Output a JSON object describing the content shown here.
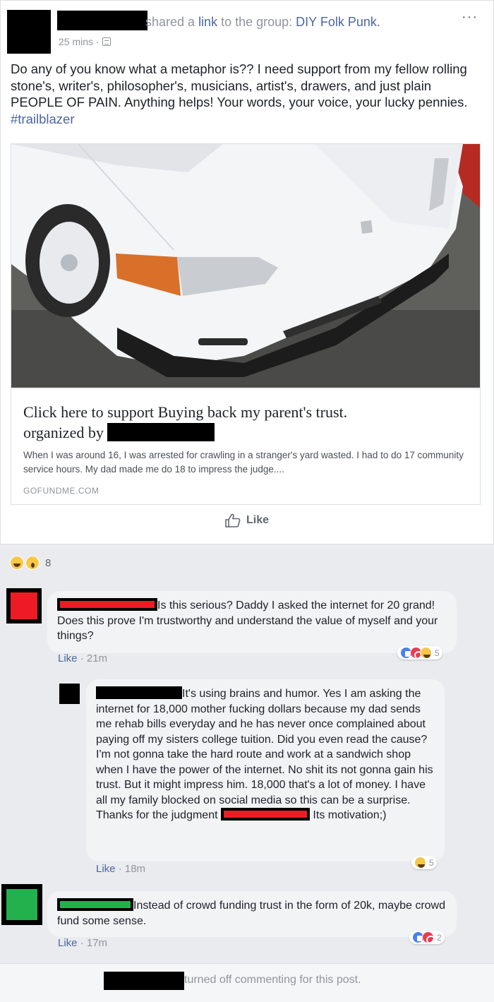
{
  "post": {
    "shared_prefix": "shared a ",
    "shared_link_word": "link",
    "shared_suffix": " to the group: ",
    "group_name": "DIY Folk Punk.",
    "timestamp": "25 mins · ",
    "more_icon": "more-dots-icon",
    "privacy_icon": "globe-icon",
    "text": "Do any of you know what a metaphor is?? I need support from my fellow rolling stone's, writer's, philosopher's, musicians, artist's, drawers, and just plain PEOPLE OF PAIN. Anything helps! Your words, your voice, your lucky pennies. ",
    "hashtag": "#trailblazer"
  },
  "link_card": {
    "title_line1": "Click here to support Buying back my parent's trust.",
    "title_line2": "organized by ",
    "description": "When I was around 16, I was arrested for crawling in a stranger's yard wasted. I had to do 17 community service hours. My dad made me do 18 to impress the judge....",
    "domain": "GOFUNDME.COM"
  },
  "actions": {
    "like_label": "Like",
    "like_icon": "thumbs-up-icon"
  },
  "reactions": {
    "icons": [
      "laugh-emoji",
      "wow-emoji"
    ],
    "count": "8"
  },
  "comments": [
    {
      "text": "Is this serious? Daddy I asked the internet for 20 grand! Does this prove I'm trustworthy and understand the value of myself and your things?",
      "like_label": "Like",
      "time": " · 21m",
      "reaction_count": "5"
    },
    {
      "text_a": "It's using brains and humor. Yes I am asking the internet for 18,000 mother fucking dollars because my dad sends me rehab bills everyday and he has never once complained about paying off my sisters college tuition. Did you even read the cause? I'm not gonna take the hard route and work at a sandwich shop when I have the power of the internet. No shit its not gonna gain his trust. But it might impress him. 18,000 that's a lot of money. I have all my family blocked on social media so this can be a surprise. Thanks for the judgment ",
      "text_b": " Its motivation;)",
      "like_label": "Like",
      "time": " · 18m",
      "reaction_count": "5"
    },
    {
      "text": "Instead of crowd funding trust in the form of 20k, maybe crowd fund some sense.",
      "like_label": "Like",
      "time": " · 17m",
      "reaction_count": "2"
    }
  ],
  "footer": {
    "text": "turned off commenting for this post."
  },
  "colors": {
    "link_blue": "#4b67a1",
    "meta_gray": "#90949c",
    "redaction_red": "#ed1c24",
    "redaction_green": "#22b14c"
  }
}
